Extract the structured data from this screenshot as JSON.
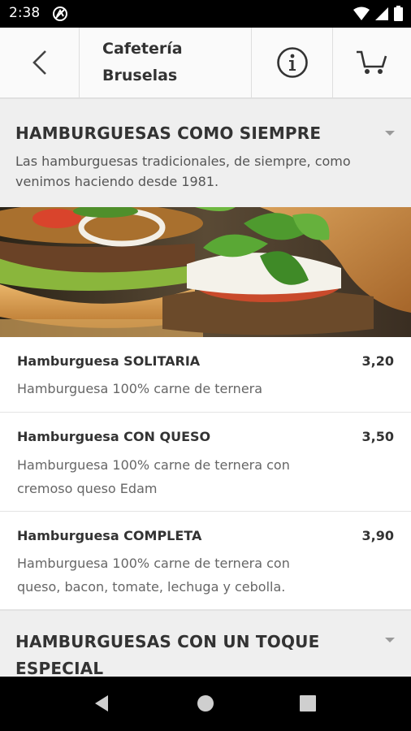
{
  "status_bar": {
    "time": "2:38",
    "icons": [
      "notification-icon",
      "wifi-icon",
      "signal-icon",
      "battery-icon"
    ]
  },
  "app_bar": {
    "title_line1": "Cafetería",
    "title_line2": "Bruselas",
    "back_icon": "chevron-left-icon",
    "info_icon": "info-icon",
    "cart_icon": "cart-icon"
  },
  "sections": [
    {
      "title": "HAMBURGUESAS COMO SIEMPRE",
      "description_line1": "Las hamburguesas tradicionales, de siempre, como",
      "description_line2": "venimos haciendo desde 1981.",
      "items": [
        {
          "name": "Hamburguesa SOLITARIA",
          "price": "3,20",
          "description_line1": "Hamburguesa 100% carne de ternera",
          "description_line2": ""
        },
        {
          "name": "Hamburguesa CON QUESO",
          "price": "3,50",
          "description_line1": "Hamburguesa 100% carne de ternera con",
          "description_line2": "cremoso queso Edam"
        },
        {
          "name": "Hamburguesa COMPLETA",
          "price": "3,90",
          "description_line1": "Hamburguesa 100% carne de ternera con",
          "description_line2": "queso, bacon, tomate, lechuga y cebolla."
        }
      ]
    },
    {
      "title_line1": "HAMBURGUESAS CON UN TOQUE",
      "title_line2": "ESPECIAL"
    }
  ],
  "nav_bar": {
    "back_icon": "nav-back-icon",
    "home_icon": "nav-home-icon",
    "recents_icon": "nav-recents-icon"
  },
  "colors": {
    "status_bar": "#000000",
    "app_bar": "#fafafa",
    "section_bg": "#efefef",
    "item_bg": "#ffffff",
    "text_dark": "#333333",
    "text_muted": "#666666"
  }
}
